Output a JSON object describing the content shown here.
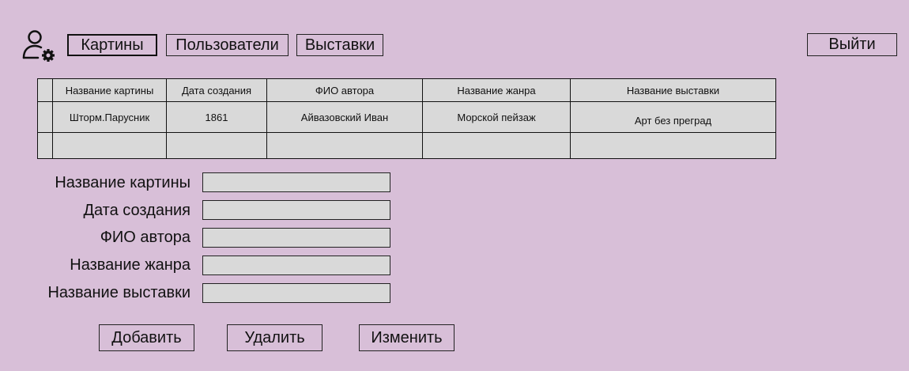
{
  "nav": {
    "tabs": [
      {
        "label": "Картины"
      },
      {
        "label": "Пользователи"
      },
      {
        "label": "Выставки"
      }
    ],
    "logout_label": "Выйти"
  },
  "table": {
    "headers": [
      "",
      "Название картины",
      "Дата создания",
      "ФИО автора",
      "Название жанра",
      "Название выставки"
    ],
    "rows": [
      [
        "",
        "Шторм.Парусник",
        "1861",
        "Айвазовский Иван",
        "Морской пейзаж",
        "Арт без преград"
      ],
      [
        "",
        "",
        "",
        "",
        "",
        ""
      ]
    ]
  },
  "form": {
    "fields": [
      {
        "label": "Название картины",
        "value": ""
      },
      {
        "label": "Дата создания",
        "value": ""
      },
      {
        "label": "ФИО автора",
        "value": ""
      },
      {
        "label": "Название жанра",
        "value": ""
      },
      {
        "label": "Название выставки",
        "value": ""
      }
    ]
  },
  "actions": {
    "add_label": "Добавить",
    "delete_label": "Удалить",
    "edit_label": "Изменить"
  },
  "icons": {
    "user_settings": "user-settings-icon"
  },
  "colors": {
    "background": "#d8bfd8",
    "cell_bg": "#d9d9d9"
  }
}
